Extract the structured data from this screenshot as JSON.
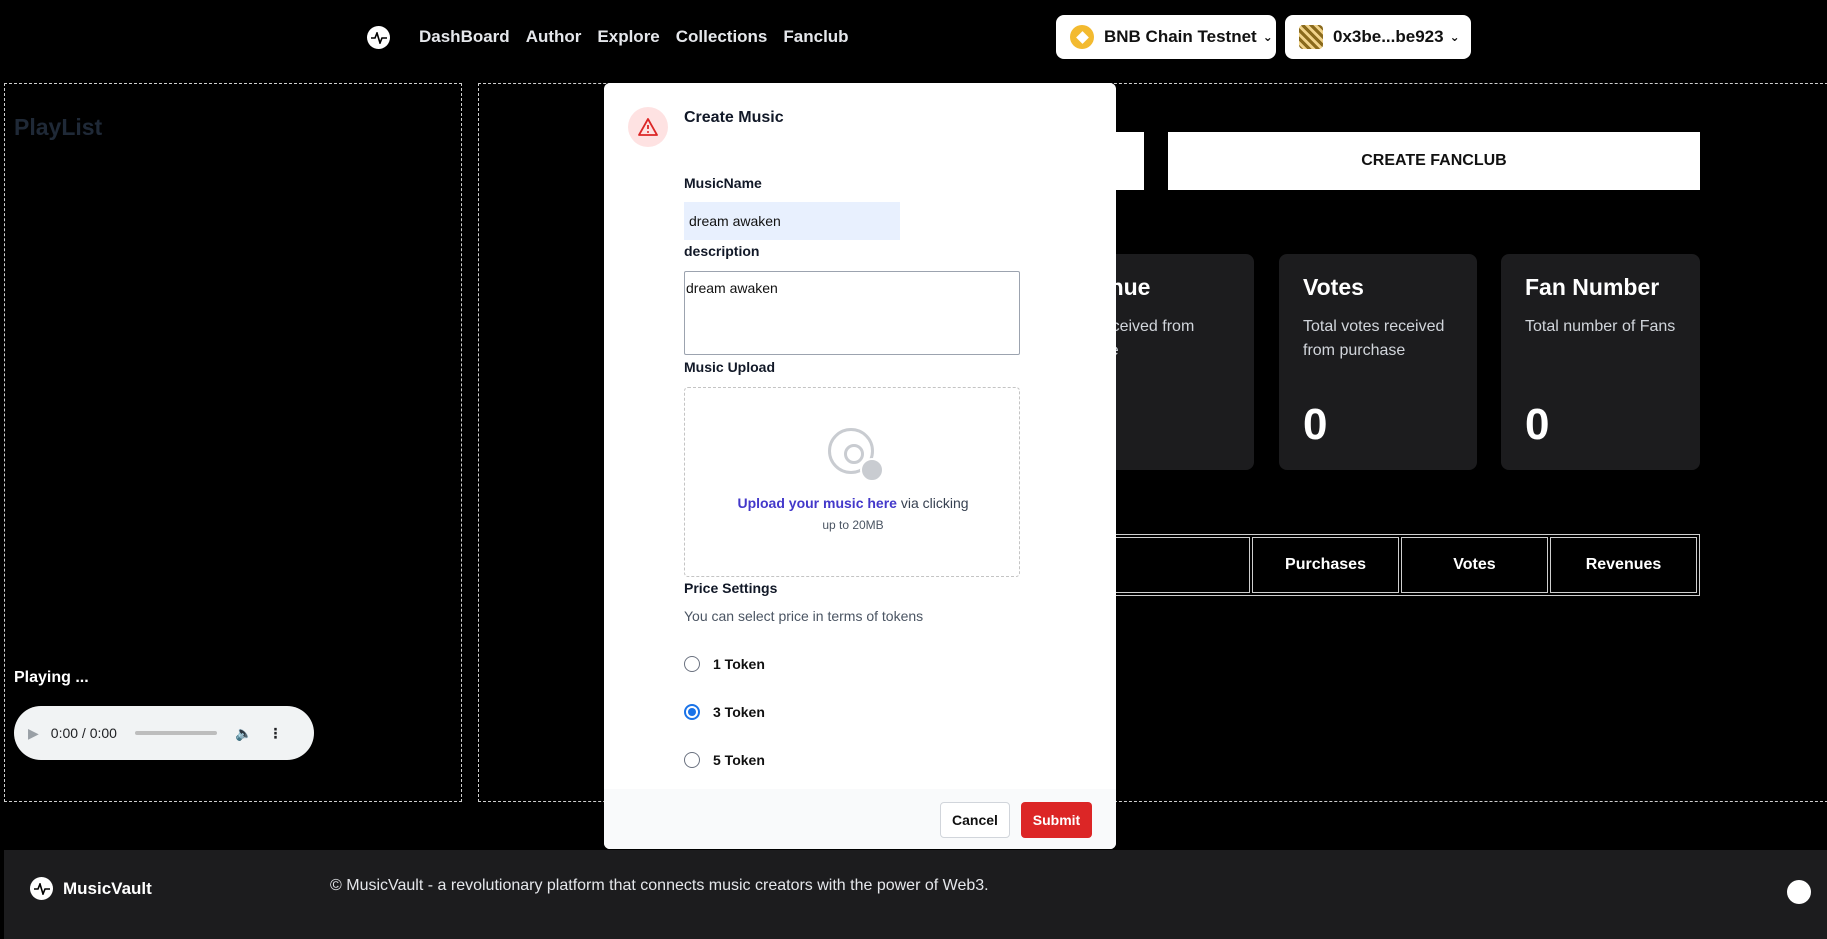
{
  "nav": {
    "links": [
      "DashBoard",
      "Author",
      "Explore",
      "Collections",
      "Fanclub"
    ],
    "chain_label": "BNB Chain Testnet",
    "account_label": "0x3be...be923"
  },
  "left": {
    "playlist_title": "PlayList",
    "playing_label": "Playing ...",
    "audio_time": "0:00 / 0:00"
  },
  "main": {
    "create_fanclub_label": "CREATE FANCLUB",
    "cards": [
      {
        "title": "venue",
        "desc": "n received from\nhase",
        "value": "0"
      },
      {
        "title": "Votes",
        "desc": "Total votes received from purchase",
        "value": "0"
      },
      {
        "title": "Fan Number",
        "desc": "Total number of Fans",
        "value": "0"
      }
    ],
    "table_headers": [
      "",
      "Purchases",
      "Votes",
      "Revenues"
    ]
  },
  "modal": {
    "title": "Create Music",
    "music_name_label": "MusicName",
    "music_name_value": "dream awaken",
    "description_label": "description",
    "description_value": "dream awaken",
    "upload_label": "Music Upload",
    "upload_link": "Upload your music here",
    "upload_rest": " via clicking",
    "upload_size": "up to 20MB",
    "price_label": "Price Settings",
    "price_sub": "You can select price in terms of tokens",
    "options": [
      "1 Token",
      "3 Token",
      "5 Token"
    ],
    "selected_option": "3 Token",
    "cancel_label": "Cancel",
    "submit_label": "Submit"
  },
  "footer": {
    "brand": "MusicVault",
    "text": "© MusicVault - a revolutionary platform that connects music creators with the power of Web3."
  },
  "colors": {
    "accent_submit": "#dc2626",
    "upload_link": "#4338ca",
    "radio_selected": "#1a73e8",
    "bnb": "#f3ba2f"
  }
}
